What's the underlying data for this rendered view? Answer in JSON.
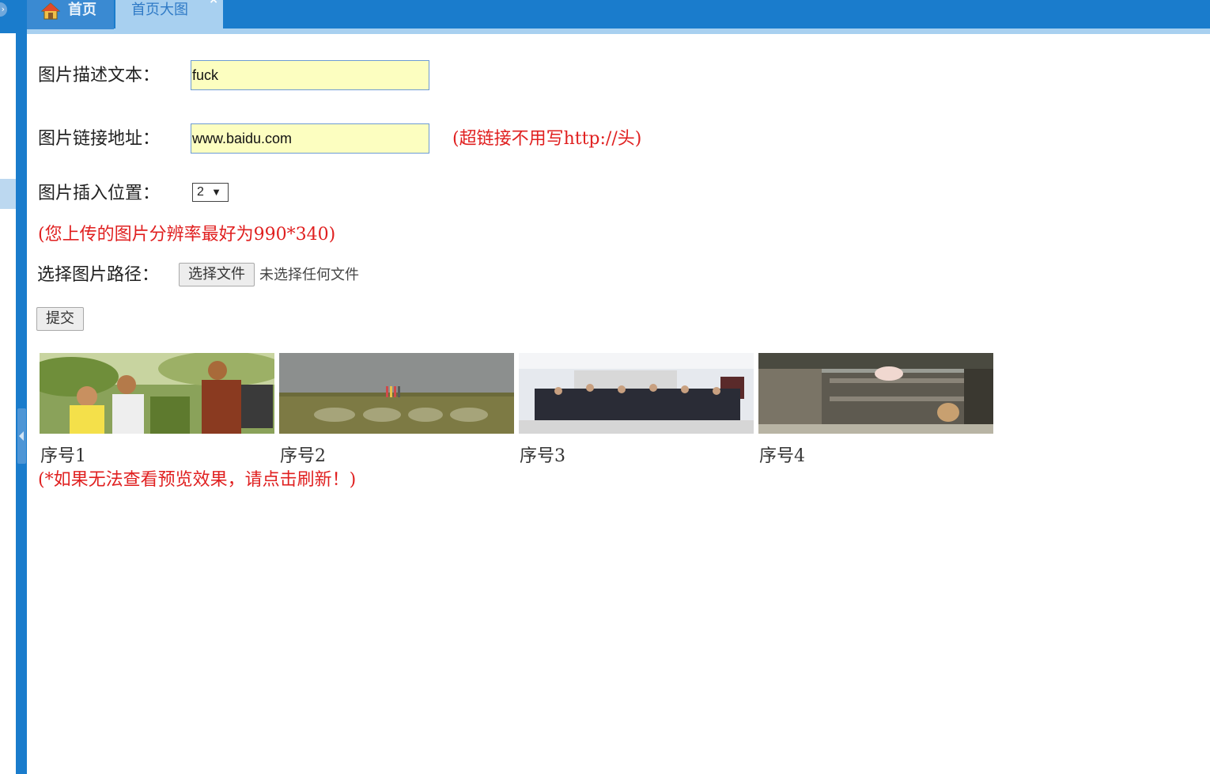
{
  "tabs": {
    "home_label": "首页",
    "active_label": "首页大图",
    "close_symbol": "×",
    "home_icon": "home-icon"
  },
  "sidebar": {
    "circle_symbol": "›"
  },
  "form": {
    "desc_label": "图片描述文本：",
    "desc_value": "fuck",
    "link_label": "图片链接地址：",
    "link_value": "www.baidu.com",
    "link_hint": "(超链接不用写http://头)",
    "position_label": "图片插入位置：",
    "position_value": "2",
    "position_arrow": "▼",
    "resolution_hint": "(您上传的图片分辨率最好为990*340)",
    "path_label": "选择图片路径：",
    "choose_file_label": "选择文件",
    "no_file_text": "未选择任何文件",
    "submit_label": "提交"
  },
  "thumbnails": [
    {
      "caption": "序号1"
    },
    {
      "caption": "序号2"
    },
    {
      "caption": "序号3"
    },
    {
      "caption": "序号4"
    }
  ],
  "refresh_hint": "(*如果无法查看预览效果，请点击刷新！)",
  "colors": {
    "brand_blue": "#1a7ccc",
    "active_tab": "#a8d0f0",
    "input_bg": "#fcfec0",
    "hint_red": "#e02020"
  }
}
